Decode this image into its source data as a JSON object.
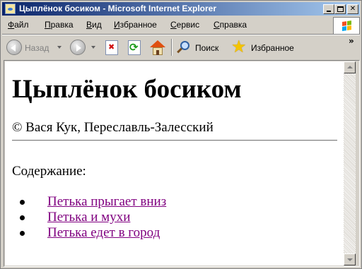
{
  "window": {
    "title": "Цыплёнок босиком - Microsoft Internet Explorer"
  },
  "menu": [
    {
      "accel": "Ф",
      "rest": "айл"
    },
    {
      "accel": "П",
      "rest": "равка"
    },
    {
      "accel": "В",
      "rest": "ид"
    },
    {
      "accel": "И",
      "rest": "збранное"
    },
    {
      "accel": "С",
      "rest": "ервис"
    },
    {
      "accel": "С",
      "rest": "правка"
    }
  ],
  "toolbar": {
    "back_label": "Назад",
    "search_label": "Поиск",
    "favorites_label": "Избранное",
    "more": "»"
  },
  "page": {
    "heading": "Цыплёнок босиком",
    "byline": "© Вася Кук, Переславль-Залесский",
    "toc_label": "Содержание:",
    "toc": [
      "Петька прыгает вниз",
      "Петька и мухи",
      "Петька едет в город"
    ]
  },
  "colors": {
    "visited_link": "#800080",
    "title_bar": "#0a246a"
  }
}
